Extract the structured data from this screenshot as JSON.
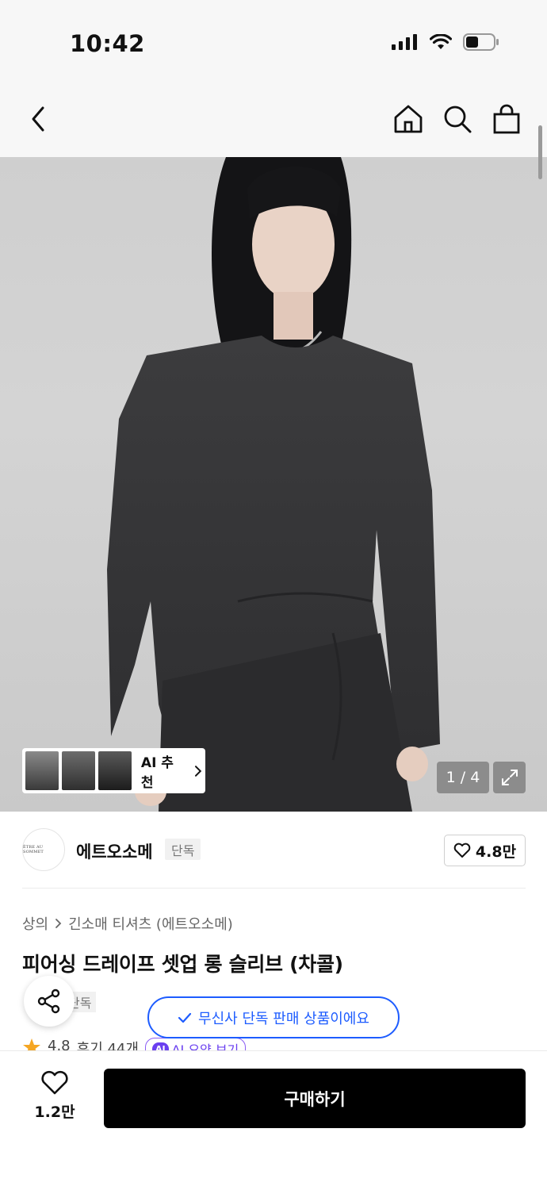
{
  "status_bar": {
    "time": "10:42",
    "icons": [
      "signal-icon",
      "wifi-icon",
      "battery-icon"
    ]
  },
  "nav": {
    "icons": [
      "back-icon",
      "home-icon",
      "search-icon",
      "shopping-bag-icon"
    ]
  },
  "gallery": {
    "current": "1",
    "total": "4",
    "counter_text": "1 / 4",
    "ai_recommend_label": "AI 추천"
  },
  "brand": {
    "logo_text": "ÊTRE AU SOMMET",
    "name": "에트오소메",
    "badge": "단독",
    "likes": "4.8만"
  },
  "breadcrumb": {
    "category": "상의",
    "subcategory": "긴소매 티셔츠 (에트오소메)"
  },
  "product": {
    "title": "피어싱 드레이프 셋업 롱 슬리브 (차콜)",
    "tag": "단독"
  },
  "toast": {
    "message": "무신사 단독 판매 상품이에요"
  },
  "rating": {
    "score": "4.8",
    "reviews": "후기 44개",
    "ai_chip": "AI",
    "ai_summary": "AI 요약 보기"
  },
  "bottom_bar": {
    "wish_count": "1.2만",
    "buy_label": "구매하기"
  },
  "colors": {
    "accent_blue": "#1d5cff",
    "ai_purple": "#6a3ff0",
    "star": "#f5a623",
    "buy_button": "#000000"
  }
}
